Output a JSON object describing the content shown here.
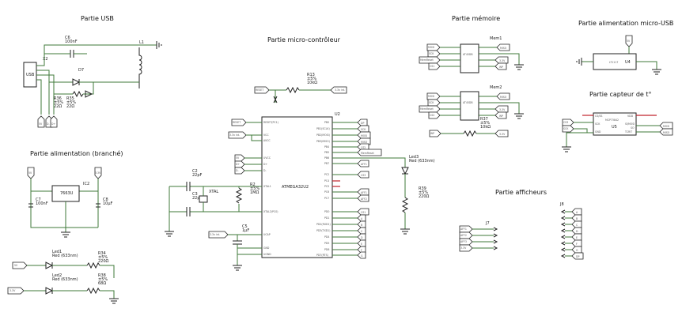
{
  "sections": {
    "usb": "Partie USB",
    "mcu": "Partie micro-contrôleur",
    "memory": "Partie mémoire",
    "power_micro_usb": "Partie alimentation micro-USB",
    "power_plugged": "Partie alimentation (branché)",
    "temp_sensor": "Partie capteur de t°",
    "displays": "Partie afficheurs"
  },
  "usb": {
    "connector": "USB",
    "x2": "X2",
    "c6_ref": "C6",
    "c6_val": "100nF",
    "l1": "L1",
    "d7": "D7",
    "r36": "R36",
    "r36_val": "±5%",
    "r36_ohm": "22Ω",
    "r35": "R35",
    "r35_val": "±5%",
    "r35_ohm": "22Ω",
    "tags": [
      "5V",
      "D-",
      "D+"
    ]
  },
  "mcu": {
    "u2": "U2",
    "chip_name": "ATMEGA32U2",
    "r13": "R13",
    "r13_val": "±5%",
    "r13_ohm": "10kΩ",
    "reset_tag": "RESET",
    "reset_tag2": "RESET",
    "v33_int": "3.3v int.",
    "v33_int2": "3.3v int.",
    "v33_int3": "3.3v int.",
    "c2": "C2",
    "c2_val": "22pF",
    "c3": "C3",
    "c3_val": "22pF",
    "xtal": "XTAL",
    "r2": "R2",
    "r2_val": "±5%",
    "r2_ohm": "1MΩ",
    "c5": "C5",
    "c5_val": "1μF",
    "left_tags": [
      "5V",
      "D+",
      "D-"
    ],
    "left_pins": [
      "RESET(PC1)",
      "VCC",
      "AVCC",
      "UVCC",
      "D+",
      "D-",
      "XTAL1",
      "XTAL2(PC0)",
      "UCAP",
      "GND",
      "UGND"
    ],
    "right_pins": [
      "PB0",
      "PB1(SCLK)",
      "PB2(MOSI)",
      "PB3(MISO)",
      "PB4",
      "PB5",
      "PB6",
      "PB7",
      "PC2",
      "PC4",
      "PC5",
      "PC6",
      "PC7",
      "PD0",
      "PD1",
      "PD2(RXD1)",
      "PD3(TXD1)",
      "PD4",
      "PD5",
      "PD6",
      "PD7(RTS)"
    ],
    "right_tags": [
      "DP",
      "SCK",
      "MOSI",
      "MISO",
      "CS2",
      "MemReset",
      "AFF1",
      "CS3",
      "AFF1",
      "AFF2",
      "CS1",
      "A",
      "B",
      "C",
      "D",
      "E",
      "F",
      "G"
    ],
    "led3": "Led3",
    "led3_val": "Red (633nm)",
    "r39": "R39",
    "r39_val": "±5%",
    "r39_ohm": "220Ω"
  },
  "memory": {
    "mem1": "Mem1",
    "mem1_chip": "AT45DB",
    "mem2": "Mem2",
    "mem2_chip": "AT45DB",
    "left1": [
      "MOSI",
      "SCK",
      "MemReset",
      "CS1"
    ],
    "right1": [
      "MISO",
      "3.3V",
      "WP"
    ],
    "left2": [
      "MOSI",
      "SCK",
      "MemReset",
      "CS2"
    ],
    "right2": [
      "MISO",
      "3.3V",
      "WP"
    ],
    "r37": "R37",
    "r37_val": "±5%",
    "r37_ohm": "10kΩ",
    "wp": "WP",
    "v33": "3.3V"
  },
  "power_micro": {
    "u4": "U4",
    "chip": "LT1117",
    "tag": "5V"
  },
  "temp": {
    "chip": "MCP73842",
    "u5": "U5",
    "left_tags": [
      "CS3",
      "SCK"
    ],
    "right_tags": [
      "MOSI",
      "MISO"
    ],
    "left_pins": [
      "CS/SS",
      "SCK",
      "GND"
    ],
    "right_pins": [
      "VDD",
      "SI/MOSI",
      "SO",
      "TCRIT"
    ]
  },
  "power_plug": {
    "ic2": "IC2",
    "chip": "7663U",
    "c7": "C7",
    "c7_val": "100nF",
    "c8": "C8",
    "c8_val": "10μF",
    "tag_in": "5V",
    "tag_out": "3.3V",
    "led1": "Led1",
    "led1_val": "Red (633nm)",
    "led2": "Led2",
    "led2_val": "Red (633nm)",
    "r34": "R34",
    "r34_val": "±5%",
    "r34_ohm": "220Ω",
    "r38": "R38",
    "r38_val": "±5%",
    "r38_ohm": "68Ω",
    "led1_tag": "5V",
    "led2_tag": "3.3V"
  },
  "displays": {
    "j7": "J7",
    "j7_tags": [
      "AFF1",
      "AFF2",
      "AFF3",
      "3.3V"
    ],
    "j8": "J8",
    "j8_tags": [
      "A",
      "B",
      "C",
      "D",
      "E",
      "F",
      "G",
      "DP"
    ]
  }
}
